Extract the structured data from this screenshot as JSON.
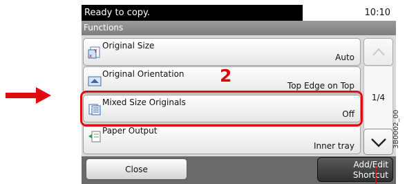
{
  "status": {
    "message": "Ready to copy.",
    "time": "10:10"
  },
  "header": {
    "title": "Functions"
  },
  "items": [
    {
      "label": "Original Size",
      "value": "Auto"
    },
    {
      "label": "Original Orientation",
      "value": "Top Edge on Top"
    },
    {
      "label": "Mixed Size Originals",
      "value": "Off"
    },
    {
      "label": "Paper Output",
      "value": "Inner tray"
    }
  ],
  "pagination": {
    "indicator": "1/4"
  },
  "buttons": {
    "close": "Close",
    "shortcut_line1": "Add/Edit",
    "shortcut_line2": "Shortcut"
  },
  "annotation": {
    "step": "2",
    "image_code": "3B0002_00"
  },
  "colors": {
    "annotation_red": "#e10a10",
    "status_bar": "#000000"
  }
}
